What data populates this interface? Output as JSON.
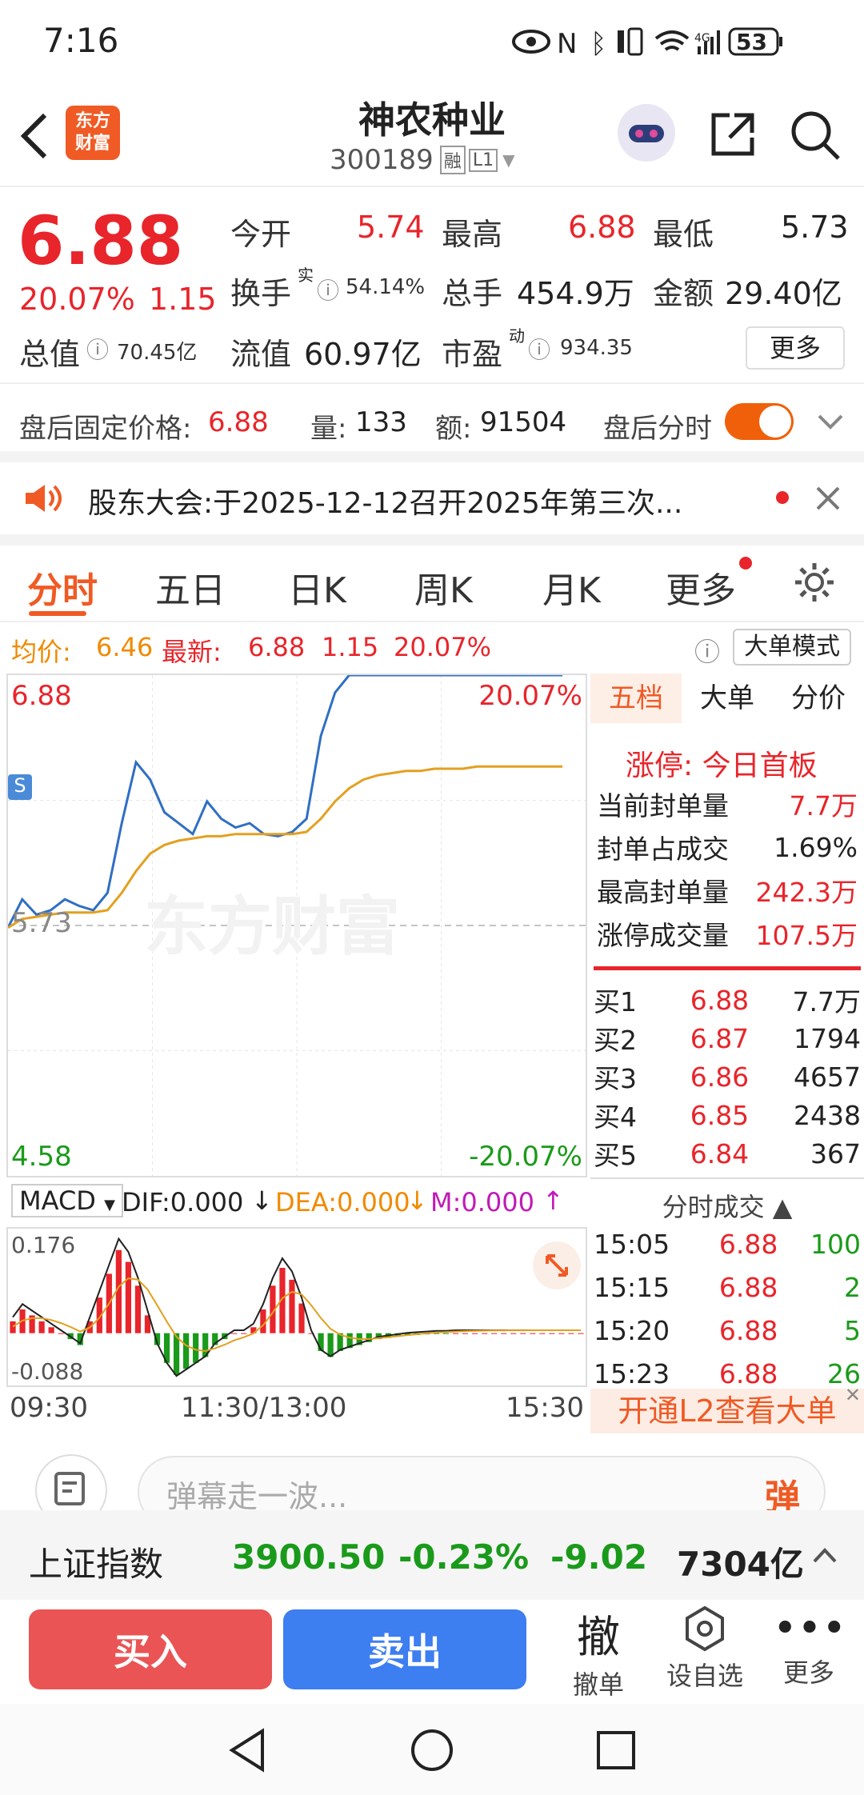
{
  "status": {
    "time": "7:16",
    "battery": "53"
  },
  "header": {
    "name": "神农种业",
    "code": "300189",
    "tag_rong": "融",
    "tag_level": "L1",
    "logo": "东方\n财富"
  },
  "quote": {
    "price": "6.88",
    "pct": "20.07%",
    "chg": "1.15",
    "open_label": "今开",
    "open": "5.74",
    "high_label": "最高",
    "high": "6.88",
    "low_label": "最低",
    "low": "5.73",
    "turnover_label": "换手",
    "turnover_sup": "实",
    "turnover": "54.14%",
    "vol_label": "总手",
    "vol": "454.9万",
    "amt_label": "金额",
    "amt": "29.40亿",
    "mcap_label": "总值",
    "mcap": "70.45亿",
    "float_label": "流值",
    "float": "60.97亿",
    "pe_label": "市盈",
    "pe_sup": "动",
    "pe": "934.35",
    "more": "更多"
  },
  "after": {
    "label": "盘后固定价格:",
    "price": "6.88",
    "vol_label": "量:",
    "vol": "133",
    "amt_label": "额:",
    "amt": "91504",
    "toggle_label": "盘后分时"
  },
  "notice": {
    "text": "股东大会:于2025-12-12召开2025年第三次..."
  },
  "tabs": [
    "分时",
    "五日",
    "日K",
    "周K",
    "月K",
    "更多"
  ],
  "avg": {
    "label": "均价:",
    "value": "6.46",
    "latest_label": "最新:",
    "latest": "6.88",
    "chg": "1.15",
    "pct": "20.07%",
    "mode": "大单模式"
  },
  "chart_data": {
    "type": "line",
    "title": "",
    "ylim": [
      4.58,
      6.88
    ],
    "y_top": "6.88",
    "y_top_pct": "20.07%",
    "y_bottom": "4.58",
    "y_bottom_pct": "-20.07%",
    "ref": "5.73",
    "x_ticks": [
      "09:30",
      "11:30/13:00",
      "15:30"
    ],
    "watermark": "东方财富",
    "series": [
      {
        "values": [
          5.72,
          5.85,
          5.78,
          5.8,
          5.85,
          5.82,
          5.8,
          5.88,
          6.2,
          6.48,
          6.4,
          6.25,
          6.2,
          6.15,
          6.3,
          6.22,
          6.18,
          6.2,
          6.15,
          6.14,
          6.16,
          6.22,
          6.6,
          6.8,
          6.88,
          6.88,
          6.88,
          6.88,
          6.88,
          6.88,
          6.88,
          6.88,
          6.88,
          6.88,
          6.88,
          6.88,
          6.88,
          6.88,
          6.88,
          6.88
        ]
      },
      {
        "values": [
          5.72,
          5.76,
          5.77,
          5.78,
          5.79,
          5.79,
          5.79,
          5.8,
          5.88,
          5.98,
          6.06,
          6.1,
          6.12,
          6.13,
          6.14,
          6.14,
          6.15,
          6.15,
          6.15,
          6.15,
          6.15,
          6.16,
          6.22,
          6.3,
          6.36,
          6.4,
          6.42,
          6.43,
          6.44,
          6.44,
          6.45,
          6.45,
          6.45,
          6.46,
          6.46,
          6.46,
          6.46,
          6.46,
          6.46,
          6.46
        ]
      }
    ]
  },
  "macd": {
    "name": "MACD",
    "dif": "DIF:0.000",
    "dea": "DEA:0.000",
    "m": "M:0.000",
    "top": "0.176",
    "bottom": "-0.088",
    "bars": [
      0.02,
      0.04,
      0.03,
      0.02,
      0.01,
      0.0,
      -0.01,
      -0.02,
      0.02,
      0.06,
      0.1,
      0.14,
      0.12,
      0.08,
      0.03,
      -0.02,
      -0.05,
      -0.07,
      -0.06,
      -0.05,
      -0.04,
      -0.02,
      -0.01,
      0.0,
      0.0,
      0.01,
      0.04,
      0.08,
      0.11,
      0.09,
      0.05,
      0.0,
      -0.03,
      -0.04,
      -0.03,
      -0.025,
      -0.02,
      -0.015,
      -0.01,
      -0.008,
      -0.006,
      -0.004,
      -0.003,
      -0.002,
      -0.001,
      -0.001,
      0,
      0,
      0,
      0,
      0,
      0,
      0,
      0,
      0,
      0,
      0,
      0,
      0,
      0
    ]
  },
  "side": {
    "tabs": [
      "五档",
      "大单",
      "分价"
    ],
    "limit_label": "涨停:",
    "limit_text": "今日首板",
    "stats": [
      {
        "k": "当前封单量",
        "v": "7.7万"
      },
      {
        "k": "封单占成交",
        "v": "1.69%"
      },
      {
        "k": "最高封单量",
        "v": "242.3万"
      },
      {
        "k": "涨停成交量",
        "v": "107.5万"
      }
    ],
    "bids": [
      {
        "k": "买1",
        "p": "6.88",
        "v": "7.7万"
      },
      {
        "k": "买2",
        "p": "6.87",
        "v": "1794"
      },
      {
        "k": "买3",
        "p": "6.86",
        "v": "4657"
      },
      {
        "k": "买4",
        "p": "6.85",
        "v": "2438"
      },
      {
        "k": "买5",
        "p": "6.84",
        "v": "367"
      }
    ],
    "ticks_title": "分时成交",
    "ticks": [
      {
        "t": "15:05",
        "p": "6.88",
        "v": "100"
      },
      {
        "t": "15:15",
        "p": "6.88",
        "v": "2"
      },
      {
        "t": "15:20",
        "p": "6.88",
        "v": "5"
      },
      {
        "t": "15:23",
        "p": "6.88",
        "v": "26"
      }
    ],
    "promo": "开通L2查看大单"
  },
  "danmu": {
    "placeholder": "弹幕走一波...",
    "btn": "弹"
  },
  "index": {
    "name": "上证指数",
    "value": "3900.50",
    "pct": "-0.23%",
    "chg": "-9.02",
    "amt": "7304亿"
  },
  "actions": {
    "buy": "买入",
    "sell": "卖出",
    "cancel_icon": "撤",
    "cancel": "撤单",
    "watch": "设自选",
    "more": "更多"
  }
}
